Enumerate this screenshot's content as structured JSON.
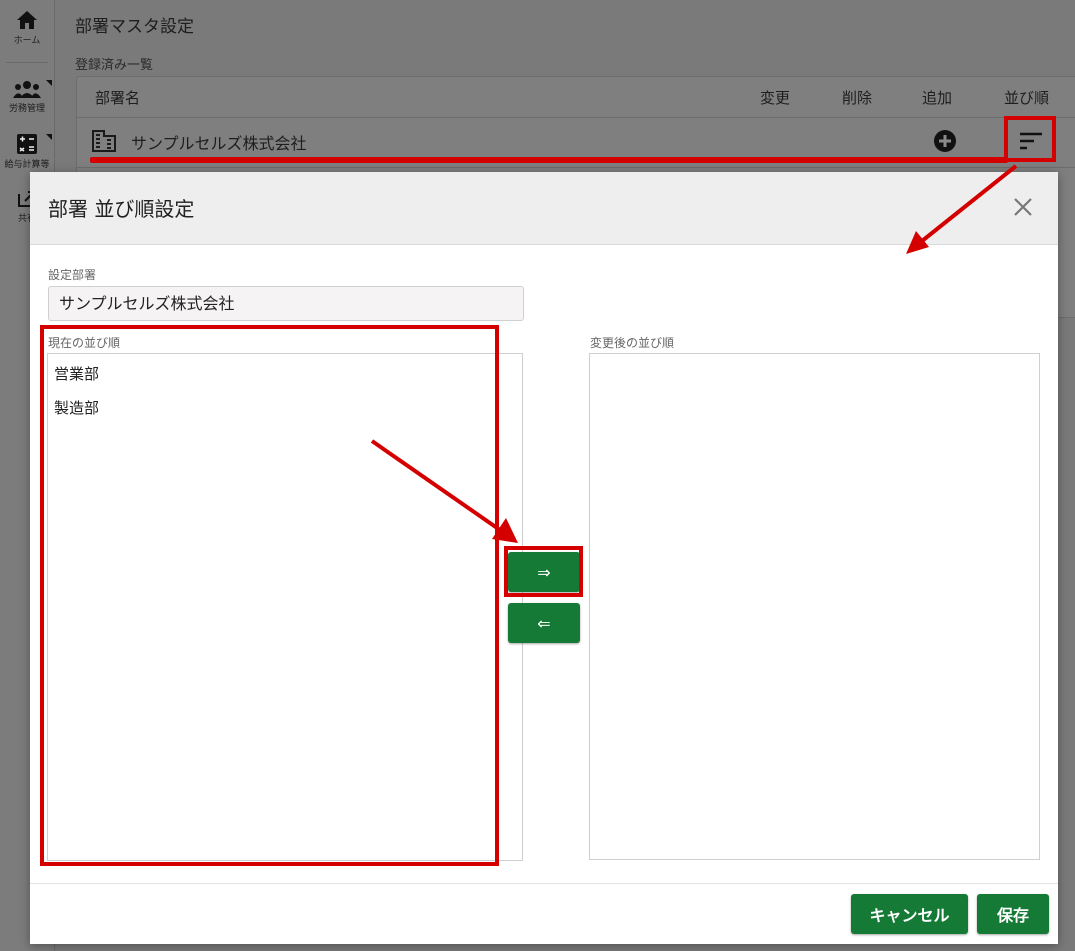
{
  "sidebar": {
    "items": [
      {
        "label": "ホーム",
        "icon": "home-icon"
      },
      {
        "label": "労務管理",
        "icon": "people-icon"
      },
      {
        "label": "給与計算等",
        "icon": "calculator-icon"
      },
      {
        "label": "共有",
        "icon": "share-icon"
      }
    ]
  },
  "page": {
    "title": "部署マスタ設定",
    "section_label": "登録済み一覧"
  },
  "list": {
    "headers": {
      "name": "部署名",
      "edit": "変更",
      "delete": "削除",
      "add": "追加",
      "order": "並び順"
    },
    "rows": [
      {
        "name": "サンプルセルズ株式会社"
      }
    ]
  },
  "dialog": {
    "title": "部署 並び順設定",
    "dept_label": "設定部署",
    "dept_value": "サンプルセルズ株式会社",
    "current_label": "現在の並び順",
    "current_items": [
      "営業部",
      "製造部"
    ],
    "after_label": "変更後の並び順",
    "move_right": "⇒",
    "move_left": "⇐",
    "cancel": "キャンセル",
    "save": "保存"
  },
  "colors": {
    "accent_green": "#157a36",
    "highlight_red": "#d40000"
  }
}
